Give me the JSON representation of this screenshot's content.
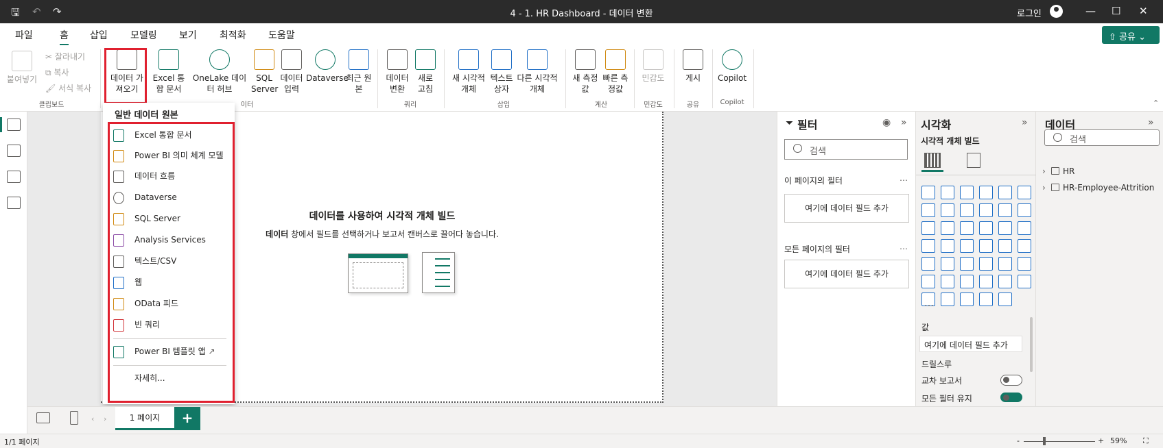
{
  "titlebar": {
    "title": "4 - 1. HR Dashboard - 데이터 변환",
    "login": "로그인",
    "minimize": "—",
    "maximize": "☐",
    "close": "✕",
    "save": "🖫",
    "undo": "↶",
    "redo": "↷"
  },
  "menu": {
    "items": [
      "파일",
      "홈",
      "삽입",
      "모델링",
      "보기",
      "최적화",
      "도움말"
    ],
    "active": "홈",
    "share": "공유"
  },
  "ribbon": {
    "clipboard": {
      "paste": "붙여넣기",
      "cut": "잘라내기",
      "copy": "복사",
      "format_painter": "서식 복사",
      "group": "클립보드"
    },
    "data": {
      "get_data": "데이터 가져오기",
      "excel": "Excel 통합 문서",
      "onelake": "OneLake 데이터 허브",
      "sql": "SQL Server",
      "enter_data": "데이터 입력",
      "dataverse": "Dataverse",
      "recent": "최근 원본",
      "group": "이터"
    },
    "queries": {
      "transform": "데이터 변환",
      "refresh": "새로 고침",
      "group": "쿼리"
    },
    "insert": {
      "new_visual": "새 시각적 개체",
      "text_box": "텍스트 상자",
      "more_visuals": "다른 시각적 개체",
      "group": "삽입"
    },
    "calc": {
      "new_measure": "새 측정값",
      "quick_measure": "빠른 측정값",
      "group": "계산"
    },
    "sensitivity": {
      "label": "민감도",
      "group": "민감도"
    },
    "share": {
      "publish": "게시",
      "group": "공유"
    },
    "copilot": {
      "label": "Copilot",
      "group": "Copilot"
    }
  },
  "dropdown": {
    "header": "일반 데이터 원본",
    "items": [
      "Excel 통합 문서",
      "Power BI 의미 체계 모델",
      "데이터 흐름",
      "Dataverse",
      "SQL Server",
      "Analysis Services",
      "텍스트/CSV",
      "웹",
      "OData 피드",
      "빈 쿼리"
    ],
    "template_app": "Power BI 템플릿 앱",
    "more": "자세히..."
  },
  "canvas": {
    "headline": "데이터를 사용하여 시각적 개체 빌드",
    "hint_bold": "데이터",
    "hint_rest": " 창에서 필드를 선택하거나 보고서 캔버스로 끌어다 놓습니다."
  },
  "filters": {
    "title": "필터",
    "search_placeholder": "검색",
    "this_page": "이 페이지의 필터",
    "all_pages": "모든 페이지의 필터",
    "add_field": "여기에 데이터 필드 추가",
    "more": "…"
  },
  "visualizations": {
    "title": "시각화",
    "build": "시각적 개체 빌드",
    "values": "값",
    "add_field": "여기에 데이터 필드 추가",
    "drillthrough": "드릴스루",
    "cross_report": "교차 보고서",
    "keep_filters": "모든 필터 유지",
    "more": "…"
  },
  "data_pane": {
    "title": "데이터",
    "search_placeholder": "검색",
    "tables": [
      "HR",
      "HR-Employee-Attrition"
    ]
  },
  "pages": {
    "tab": "1 페이지",
    "add": "+"
  },
  "status": {
    "page": "1/1 페이지",
    "zoom": "59%",
    "minus": "-",
    "plus": "+"
  },
  "colors": {
    "accent": "#117865",
    "highlight": "#e0202f",
    "titlebar": "#2b2b2b"
  }
}
